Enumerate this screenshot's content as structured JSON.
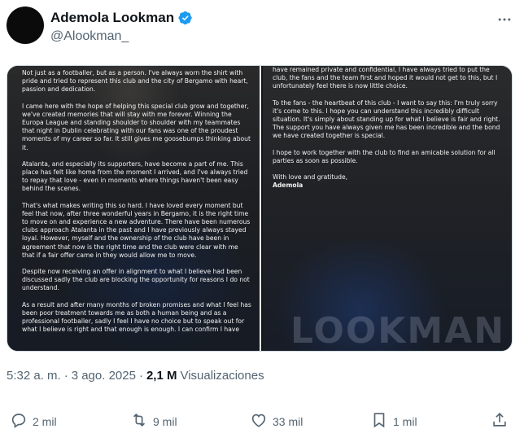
{
  "author": {
    "display_name": "Ademola Lookman",
    "handle": "@Alookman_"
  },
  "media": {
    "left_paragraphs": [
      "Not just as a footballer, but as a person. I've always worn the shirt with pride and tried to represent this club and the city of Bergamo with heart, passion and dedication.",
      "I came here with the hope of helping this special club grow and together, we've created memories that will stay with me forever. Winning the Europa League and standing shoulder to shoulder with my teammates that night in Dublin celebrating with our fans was one of the proudest moments of my career so far. It still gives me goosebumps thinking about it.",
      "Atalanta, and especially its supporters, have become a part of me. This place has felt like home from the moment I arrived, and I've always tried to repay that love - even in moments where things haven't been easy behind the scenes.",
      "That's what makes writing this so hard. I have loved every moment but feel that now, after three wonderful years in Bergamo, it is the right time to move on and experience a new adventure. There have been numerous clubs approach Atalanta in the past and I have previously always stayed loyal. However, myself and the ownership of the club have been in agreement that now is the right time and the club were clear with me that if a fair offer came in they would allow me to move.",
      "Despite now receiving an offer in alignment to what I believe had been discussed sadly the club are blocking the opportunity for reasons I do not understand.",
      "As a result and after many months of broken promises and what I feel has been poor treatment towards me as both a human being and as a professional footballer, sadly I feel I have no choice but to speak out for what I believe is right and that enough is enough. I can confirm I have"
    ],
    "right_paragraphs": [
      "have remained private and confidential, I have always tried to put the club, the fans and the team first and hoped it would not get to this, but I unfortunately feel there is now little choice.",
      "To the fans - the heartbeat of this club - I want to say this: I'm truly sorry it's come to this. I hope you can understand this incredibly difficult situation. It's simply about standing up for what I believe is fair and right. The support you have always given me has been incredible and the bond we have created together is special.",
      "I hope to work together with the club to find an amicable solution for all parties as soon as possible."
    ],
    "closing": "With love and gratitude,",
    "signature": "Ademola",
    "jersey_text": "LOOKMAN"
  },
  "meta": {
    "time": "5:32 a. m.",
    "separator": "·",
    "date": "3 ago. 2025",
    "views_count": "2,1 M",
    "views_label": "Visualizaciones"
  },
  "actions": {
    "replies": "2 mil",
    "reposts": "9 mil",
    "likes": "33 mil",
    "bookmarks": "1 mil"
  },
  "icons": {
    "verified": "verified-badge-icon",
    "more": "more-horizontal-icon",
    "reply": "reply-icon",
    "repost": "repost-icon",
    "like": "heart-icon",
    "bookmark": "bookmark-icon",
    "share": "share-icon"
  },
  "colors": {
    "verified_blue": "#1d9bf0",
    "muted_text": "#536471",
    "primary_text": "#0f1419"
  }
}
